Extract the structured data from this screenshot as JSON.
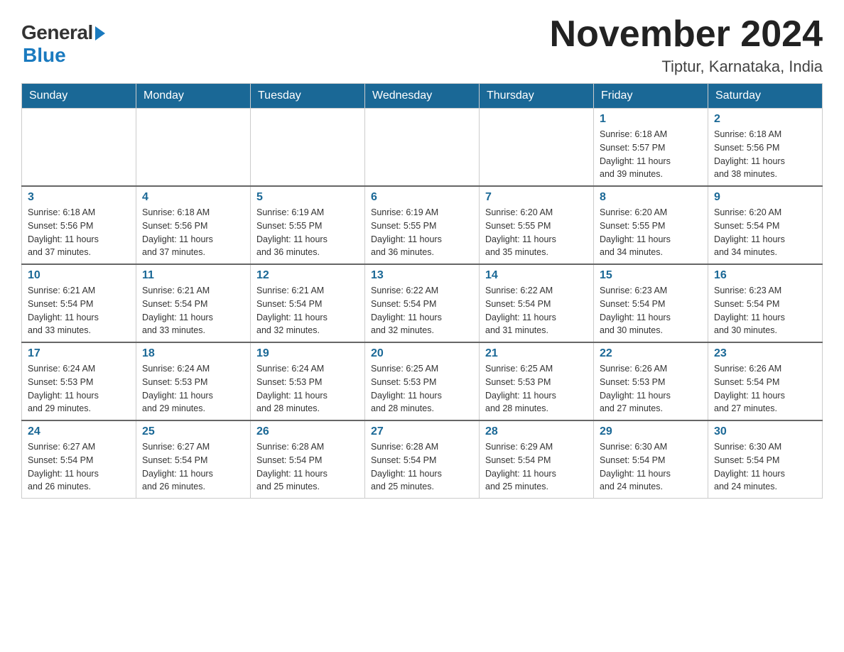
{
  "logo": {
    "general_text": "General",
    "blue_text": "Blue"
  },
  "title": "November 2024",
  "location": "Tiptur, Karnataka, India",
  "days_of_week": [
    "Sunday",
    "Monday",
    "Tuesday",
    "Wednesday",
    "Thursday",
    "Friday",
    "Saturday"
  ],
  "weeks": [
    [
      {
        "day": "",
        "info": ""
      },
      {
        "day": "",
        "info": ""
      },
      {
        "day": "",
        "info": ""
      },
      {
        "day": "",
        "info": ""
      },
      {
        "day": "",
        "info": ""
      },
      {
        "day": "1",
        "info": "Sunrise: 6:18 AM\nSunset: 5:57 PM\nDaylight: 11 hours\nand 39 minutes."
      },
      {
        "day": "2",
        "info": "Sunrise: 6:18 AM\nSunset: 5:56 PM\nDaylight: 11 hours\nand 38 minutes."
      }
    ],
    [
      {
        "day": "3",
        "info": "Sunrise: 6:18 AM\nSunset: 5:56 PM\nDaylight: 11 hours\nand 37 minutes."
      },
      {
        "day": "4",
        "info": "Sunrise: 6:18 AM\nSunset: 5:56 PM\nDaylight: 11 hours\nand 37 minutes."
      },
      {
        "day": "5",
        "info": "Sunrise: 6:19 AM\nSunset: 5:55 PM\nDaylight: 11 hours\nand 36 minutes."
      },
      {
        "day": "6",
        "info": "Sunrise: 6:19 AM\nSunset: 5:55 PM\nDaylight: 11 hours\nand 36 minutes."
      },
      {
        "day": "7",
        "info": "Sunrise: 6:20 AM\nSunset: 5:55 PM\nDaylight: 11 hours\nand 35 minutes."
      },
      {
        "day": "8",
        "info": "Sunrise: 6:20 AM\nSunset: 5:55 PM\nDaylight: 11 hours\nand 34 minutes."
      },
      {
        "day": "9",
        "info": "Sunrise: 6:20 AM\nSunset: 5:54 PM\nDaylight: 11 hours\nand 34 minutes."
      }
    ],
    [
      {
        "day": "10",
        "info": "Sunrise: 6:21 AM\nSunset: 5:54 PM\nDaylight: 11 hours\nand 33 minutes."
      },
      {
        "day": "11",
        "info": "Sunrise: 6:21 AM\nSunset: 5:54 PM\nDaylight: 11 hours\nand 33 minutes."
      },
      {
        "day": "12",
        "info": "Sunrise: 6:21 AM\nSunset: 5:54 PM\nDaylight: 11 hours\nand 32 minutes."
      },
      {
        "day": "13",
        "info": "Sunrise: 6:22 AM\nSunset: 5:54 PM\nDaylight: 11 hours\nand 32 minutes."
      },
      {
        "day": "14",
        "info": "Sunrise: 6:22 AM\nSunset: 5:54 PM\nDaylight: 11 hours\nand 31 minutes."
      },
      {
        "day": "15",
        "info": "Sunrise: 6:23 AM\nSunset: 5:54 PM\nDaylight: 11 hours\nand 30 minutes."
      },
      {
        "day": "16",
        "info": "Sunrise: 6:23 AM\nSunset: 5:54 PM\nDaylight: 11 hours\nand 30 minutes."
      }
    ],
    [
      {
        "day": "17",
        "info": "Sunrise: 6:24 AM\nSunset: 5:53 PM\nDaylight: 11 hours\nand 29 minutes."
      },
      {
        "day": "18",
        "info": "Sunrise: 6:24 AM\nSunset: 5:53 PM\nDaylight: 11 hours\nand 29 minutes."
      },
      {
        "day": "19",
        "info": "Sunrise: 6:24 AM\nSunset: 5:53 PM\nDaylight: 11 hours\nand 28 minutes."
      },
      {
        "day": "20",
        "info": "Sunrise: 6:25 AM\nSunset: 5:53 PM\nDaylight: 11 hours\nand 28 minutes."
      },
      {
        "day": "21",
        "info": "Sunrise: 6:25 AM\nSunset: 5:53 PM\nDaylight: 11 hours\nand 28 minutes."
      },
      {
        "day": "22",
        "info": "Sunrise: 6:26 AM\nSunset: 5:53 PM\nDaylight: 11 hours\nand 27 minutes."
      },
      {
        "day": "23",
        "info": "Sunrise: 6:26 AM\nSunset: 5:54 PM\nDaylight: 11 hours\nand 27 minutes."
      }
    ],
    [
      {
        "day": "24",
        "info": "Sunrise: 6:27 AM\nSunset: 5:54 PM\nDaylight: 11 hours\nand 26 minutes."
      },
      {
        "day": "25",
        "info": "Sunrise: 6:27 AM\nSunset: 5:54 PM\nDaylight: 11 hours\nand 26 minutes."
      },
      {
        "day": "26",
        "info": "Sunrise: 6:28 AM\nSunset: 5:54 PM\nDaylight: 11 hours\nand 25 minutes."
      },
      {
        "day": "27",
        "info": "Sunrise: 6:28 AM\nSunset: 5:54 PM\nDaylight: 11 hours\nand 25 minutes."
      },
      {
        "day": "28",
        "info": "Sunrise: 6:29 AM\nSunset: 5:54 PM\nDaylight: 11 hours\nand 25 minutes."
      },
      {
        "day": "29",
        "info": "Sunrise: 6:30 AM\nSunset: 5:54 PM\nDaylight: 11 hours\nand 24 minutes."
      },
      {
        "day": "30",
        "info": "Sunrise: 6:30 AM\nSunset: 5:54 PM\nDaylight: 11 hours\nand 24 minutes."
      }
    ]
  ]
}
